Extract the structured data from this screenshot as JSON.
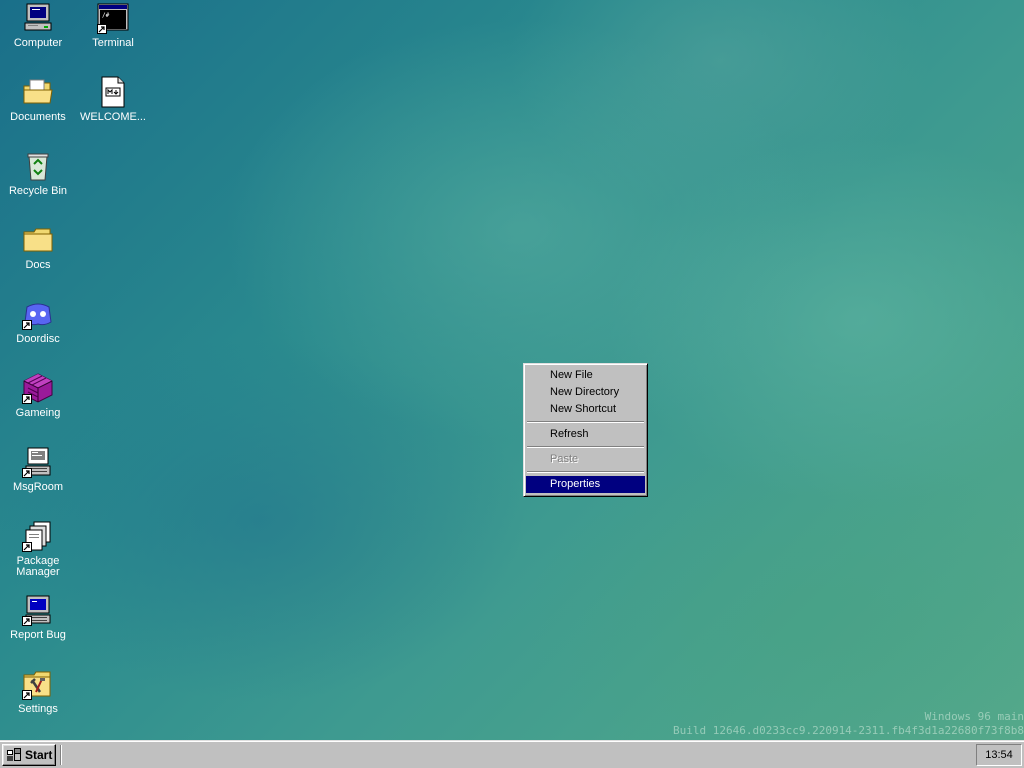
{
  "desktop": {
    "icons": [
      {
        "label": "Computer",
        "icon": "computer-icon"
      },
      {
        "label": "Documents",
        "icon": "documents-folder-icon"
      },
      {
        "label": "Recycle Bin",
        "icon": "recycle-bin-icon"
      },
      {
        "label": "Docs",
        "icon": "folder-icon"
      },
      {
        "label": "Doordisc",
        "icon": "doordisc-icon"
      },
      {
        "label": "Gameing",
        "icon": "gameing-icon"
      },
      {
        "label": "MsgRoom",
        "icon": "msgroom-icon"
      },
      {
        "label": "Package Manager",
        "icon": "package-manager-icon"
      },
      {
        "label": "Report Bug",
        "icon": "report-bug-icon"
      },
      {
        "label": "Settings",
        "icon": "settings-icon"
      },
      {
        "label": "Terminal",
        "icon": "terminal-icon"
      },
      {
        "label": "WELCOME...",
        "icon": "markdown-file-icon"
      }
    ]
  },
  "context_menu": {
    "items": [
      {
        "label": "New File",
        "state": "normal"
      },
      {
        "label": "New Directory",
        "state": "normal"
      },
      {
        "label": "New Shortcut",
        "state": "normal"
      },
      {
        "label": "Refresh",
        "state": "normal"
      },
      {
        "label": "Paste",
        "state": "disabled"
      },
      {
        "label": "Properties",
        "state": "selected"
      }
    ]
  },
  "watermark": {
    "line1": "Windows 96 main",
    "line2": "Build 12646.d0233cc9.220914-2311.fb4f3d1a22680f73f8b8"
  },
  "taskbar": {
    "start_label": "Start",
    "clock": "13:54"
  },
  "colors": {
    "menu_highlight": "#000080",
    "window_face": "#c0c0c0"
  }
}
